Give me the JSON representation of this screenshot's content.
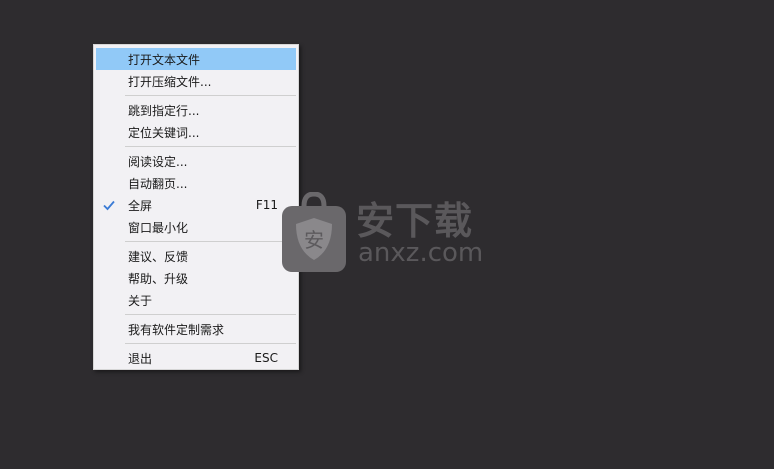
{
  "menu": {
    "items": [
      {
        "label": "打开文本文件",
        "shortcut": ""
      },
      {
        "label": "打开压缩文件...",
        "shortcut": ""
      },
      {
        "label": "跳到指定行...",
        "shortcut": ""
      },
      {
        "label": "定位关键词...",
        "shortcut": ""
      },
      {
        "label": "阅读设定...",
        "shortcut": ""
      },
      {
        "label": "自动翻页...",
        "shortcut": ""
      },
      {
        "label": "全屏",
        "shortcut": "F11",
        "checked": true
      },
      {
        "label": "窗口最小化",
        "shortcut": ""
      },
      {
        "label": "建议、反馈",
        "shortcut": ""
      },
      {
        "label": "帮助、升级",
        "shortcut": ""
      },
      {
        "label": "关于",
        "shortcut": ""
      },
      {
        "label": "我有软件定制需求",
        "shortcut": ""
      },
      {
        "label": "退出",
        "shortcut": "ESC"
      }
    ]
  },
  "watermark": {
    "title": "安下载",
    "subtitle": "anxz.com",
    "shield_char": "安"
  },
  "colors": {
    "background": "#2e2c2f",
    "menu_bg": "#f2f1f4",
    "highlight": "#91c9f7",
    "check": "#3a7bd5"
  }
}
